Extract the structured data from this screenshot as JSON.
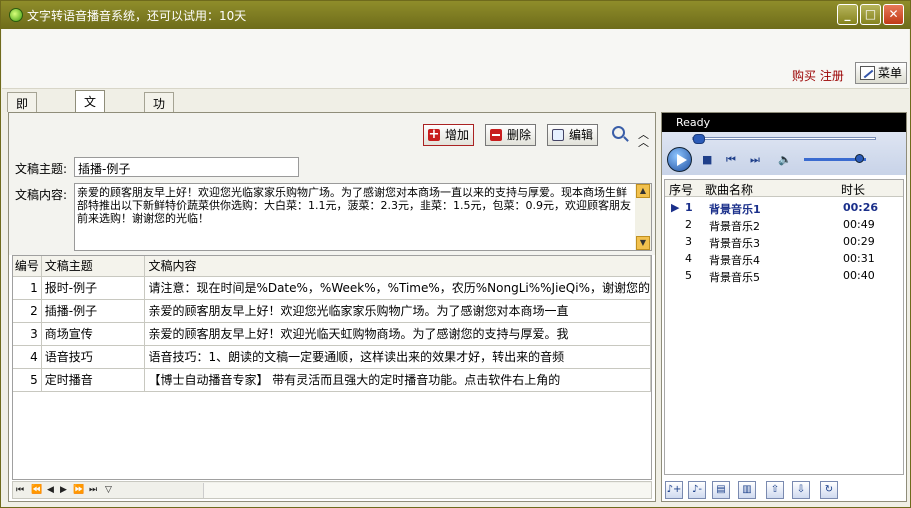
{
  "window": {
    "title": "文字转语音播音系统，还可以试用：10天",
    "controls": [
      "minimize",
      "maximize",
      "close"
    ]
  },
  "header": {
    "buy_register": "购买 注册",
    "menu_button": "菜单"
  },
  "tabs": [
    {
      "label": "即时播音",
      "active": false
    },
    {
      "label": "文稿维护",
      "active": true
    },
    {
      "label": "功能设置",
      "active": false
    }
  ],
  "toolbar": {
    "add": "增加",
    "delete": "删除",
    "edit": "编辑"
  },
  "form": {
    "subject_label": "文稿主题:",
    "subject_value": "插播-例子",
    "content_label": "文稿内容:",
    "content_value": "亲爱的顾客朋友早上好！欢迎您光临家家乐购物广场。为了感谢您对本商场一直以来的支持与厚爱。现本商场生鲜部特推出以下新鲜特价蔬菜供你选购：大白菜：1.1元，菠菜：2.3元，韭菜：1.5元，包菜：0.9元，欢迎顾客朋友前来选购！谢谢您的光临！"
  },
  "grid": {
    "columns": [
      "编号",
      "文稿主题",
      "文稿内容"
    ],
    "rows": [
      {
        "id": "1",
        "subject": "报时-例子",
        "content": "请注意：现在时间是%Date%，%Week%，%Time%，农历%NongLi%%JieQi%，谢谢您的"
      },
      {
        "id": "2",
        "subject": "插播-例子",
        "content": "亲爱的顾客朋友早上好！欢迎您光临家家乐购物广场。为了感谢您对本商场一直"
      },
      {
        "id": "3",
        "subject": "商场宣传",
        "content": "亲爱的顾客朋友早上好！欢迎光临天虹购物商场。为了感谢您的支持与厚爱。我"
      },
      {
        "id": "4",
        "subject": "语音技巧",
        "content": "语音技巧：1、朗读的文稿一定要通顺，这样读出来的效果才好，转出来的音频"
      },
      {
        "id": "5",
        "subject": "定时播音",
        "content": "【博士自动播音专家】 带有灵活而且强大的定时播音功能。点击软件右上角的"
      }
    ]
  },
  "player": {
    "status": "Ready",
    "volume": 0.9,
    "position": 0.0
  },
  "playlist": {
    "columns": [
      "序号",
      "歌曲名称",
      "时长"
    ],
    "items": [
      {
        "no": "1",
        "name": "背景音乐1",
        "duration": "00:26",
        "current": true
      },
      {
        "no": "2",
        "name": "背景音乐2",
        "duration": "00:49",
        "current": false
      },
      {
        "no": "3",
        "name": "背景音乐3",
        "duration": "00:29",
        "current": false
      },
      {
        "no": "4",
        "name": "背景音乐4",
        "duration": "00:31",
        "current": false
      },
      {
        "no": "5",
        "name": "背景音乐5",
        "duration": "00:40",
        "current": false
      }
    ]
  },
  "icons": {
    "play": "play-icon",
    "stop": "stop-icon",
    "prev": "previous-icon",
    "next": "next-icon",
    "volume": "speaker-icon",
    "playlist_tools": [
      "add-music-icon",
      "remove-music-icon",
      "add-folder-icon",
      "trash-icon",
      "move-up-icon",
      "move-down-icon",
      "loop-icon"
    ]
  }
}
